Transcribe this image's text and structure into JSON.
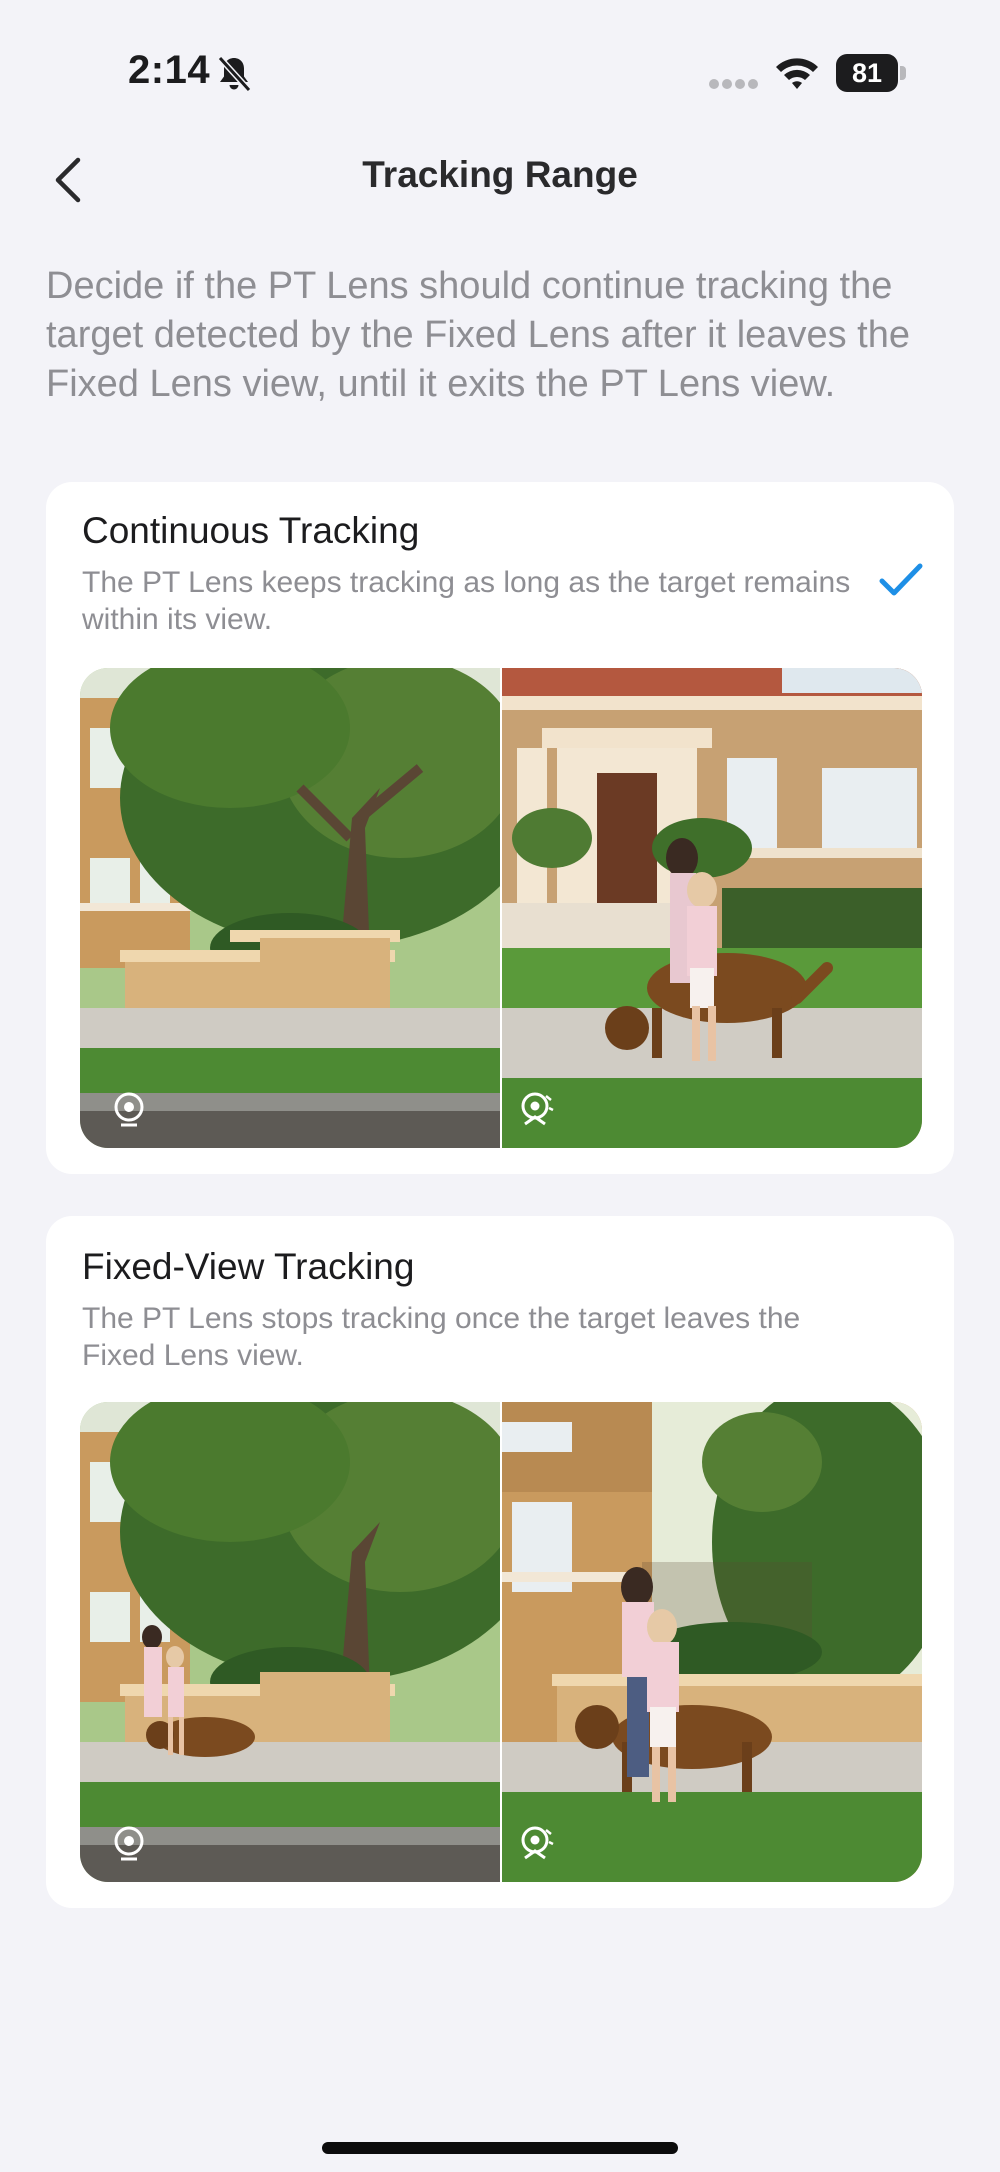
{
  "status_bar": {
    "time": "2:14",
    "battery": "81"
  },
  "nav": {
    "title": "Tracking Range"
  },
  "intro": "Decide if the PT Lens should continue tracking the target detected by the Fixed Lens after it leaves the Fixed Lens view, until it exits the PT Lens view.",
  "options": [
    {
      "title": "Continuous Tracking",
      "description": "The PT Lens keeps tracking as long as the target remains within its view.",
      "selected": true
    },
    {
      "title": "Fixed-View Tracking",
      "description": "The PT Lens stops tracking once the target leaves the Fixed Lens view.",
      "selected": false
    }
  ],
  "colors": {
    "accent": "#1e8fe6",
    "background": "#f3f3f8"
  },
  "icons": [
    "bell-slash-icon",
    "cellular-signal-icon",
    "wifi-icon",
    "battery-icon",
    "back-chevron-icon",
    "checkmark-icon",
    "fixed-lens-icon",
    "pt-lens-icon"
  ]
}
